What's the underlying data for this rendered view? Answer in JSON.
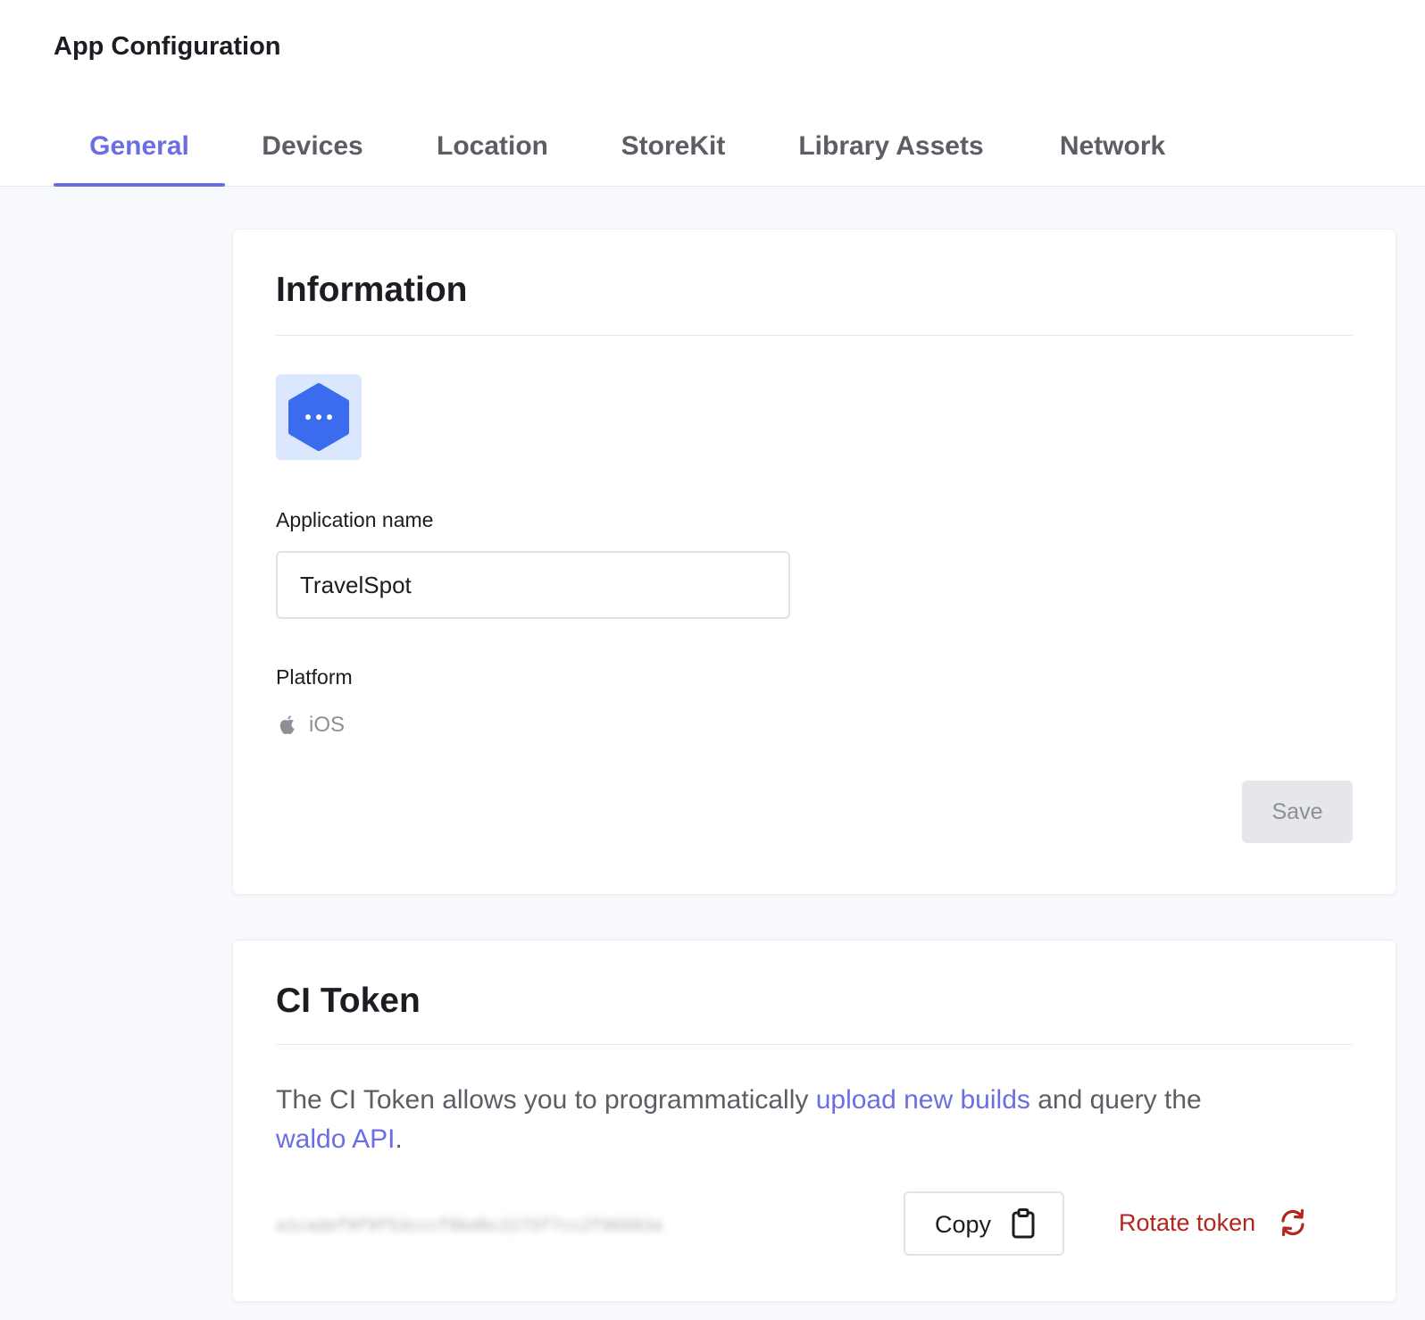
{
  "header": {
    "title": "App Configuration"
  },
  "tabs": [
    {
      "label": "General",
      "active": true
    },
    {
      "label": "Devices"
    },
    {
      "label": "Location"
    },
    {
      "label": "StoreKit"
    },
    {
      "label": "Library Assets"
    },
    {
      "label": "Network"
    }
  ],
  "information": {
    "title": "Information",
    "app_icon": "hexagon-dots-icon",
    "app_name_label": "Application name",
    "app_name_value": "TravelSpot",
    "platform_label": "Platform",
    "platform_icon": "apple-icon",
    "platform_value": "iOS",
    "save_label": "Save"
  },
  "ci_token": {
    "title": "CI Token",
    "description_before": "The CI Token allows you to programmatically ",
    "link1": "upload new builds",
    "description_middle": " and query the ",
    "link2": "waldo API",
    "description_after": ".",
    "token_masked": "a1cadef9f9f53cccf8bd6c2275f7cc2f96883a",
    "copy_label": "Copy",
    "copy_icon": "clipboard-icon",
    "rotate_label": "Rotate token",
    "rotate_icon": "refresh-icon"
  },
  "colors": {
    "accent": "#6b6ee3",
    "danger": "#b3261e",
    "app_icon": "#3b6cf0",
    "app_icon_bg": "#dbe7fd"
  }
}
